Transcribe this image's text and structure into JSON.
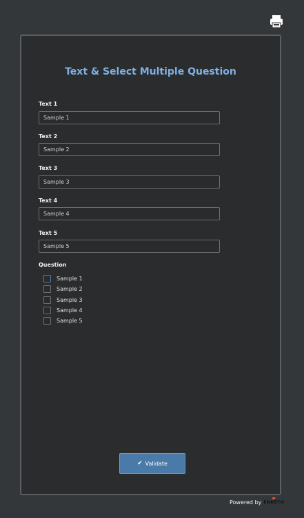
{
  "form": {
    "title": "Text & Select Multiple Question",
    "text_questions": [
      {
        "label": "Text 1",
        "value": "Sample 1"
      },
      {
        "label": "Text 2",
        "value": "Sample 2"
      },
      {
        "label": "Text 3",
        "value": "Sample 3"
      },
      {
        "label": "Text 4",
        "value": "Sample 4"
      },
      {
        "label": "Text 5",
        "value": "Sample 5"
      }
    ],
    "select_question": {
      "label": "Question",
      "options": [
        "Sample 1",
        "Sample 2",
        "Sample 3",
        "Sample 4",
        "Sample 5"
      ]
    },
    "validate_label": "Validate"
  },
  "footer": {
    "powered_by": "Powered by",
    "brand": "ENKETO"
  },
  "icons": {
    "print": "print-icon",
    "validate": "check-icon"
  },
  "colors": {
    "accent": "#4a7ba8",
    "title": "#7fb0e4",
    "background": "#343739",
    "card": "#2b2c2e"
  }
}
